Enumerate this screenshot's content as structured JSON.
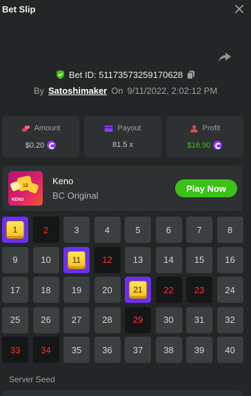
{
  "header": {
    "title": "Bet Slip"
  },
  "bet": {
    "id_text": "Bet ID: 51173573259170628",
    "by_label": "By",
    "user": "Satoshimaker",
    "on_label": "On",
    "datetime": "9/11/2022, 2:02:12 PM"
  },
  "stats": {
    "amount": {
      "label": "Amount",
      "value": "$0.20",
      "icon": "coins-icon"
    },
    "payout": {
      "label": "Payout",
      "value": "81.5 x",
      "icon": "wallet-icon"
    },
    "profit": {
      "label": "Profit",
      "value": "$16.90",
      "icon": "profit-icon"
    }
  },
  "game": {
    "name": "Keno",
    "provider": "BC Original",
    "play_label": "Play Now",
    "thumb_label": "KENO"
  },
  "grid": {
    "numbers": [
      "1",
      "2",
      "3",
      "4",
      "5",
      "6",
      "7",
      "8",
      "9",
      "10",
      "11",
      "12",
      "13",
      "14",
      "15",
      "16",
      "17",
      "18",
      "19",
      "20",
      "21",
      "22",
      "23",
      "24",
      "25",
      "26",
      "27",
      "28",
      "29",
      "30",
      "31",
      "32",
      "33",
      "34",
      "35",
      "36",
      "37",
      "38",
      "39",
      "40"
    ],
    "hits": [
      1,
      11,
      21
    ],
    "misses": [
      2,
      12,
      22,
      23,
      29,
      33,
      34
    ]
  },
  "server_seed": {
    "label": "Server Seed"
  },
  "colors": {
    "background": "#232626",
    "card": "#2d3131",
    "tile": "#3a3f3f",
    "miss_tile": "#151717",
    "miss_text": "#ff2e2e",
    "hit_tile": "#6a2ff0",
    "gem": "#f5c21a",
    "play": "#3bc117",
    "profit": "#3bc117"
  }
}
